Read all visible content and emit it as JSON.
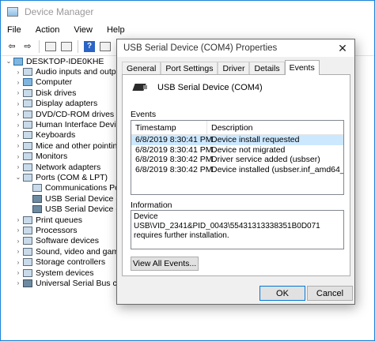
{
  "device_manager": {
    "title": "Device Manager",
    "menu": [
      "File",
      "Action",
      "View",
      "Help"
    ],
    "tree": [
      {
        "label": "DESKTOP-IDE0KHE",
        "expander": "⌄",
        "indent": 0,
        "icon": "computer-icon"
      },
      {
        "label": "Audio inputs and outpu",
        "expander": "›",
        "indent": 1,
        "icon": "audio-icon"
      },
      {
        "label": "Computer",
        "expander": "›",
        "indent": 1,
        "icon": "computer-icon"
      },
      {
        "label": "Disk drives",
        "expander": "›",
        "indent": 1,
        "icon": "disk-icon"
      },
      {
        "label": "Display adapters",
        "expander": "›",
        "indent": 1,
        "icon": "display-icon"
      },
      {
        "label": "DVD/CD-ROM drives",
        "expander": "›",
        "indent": 1,
        "icon": "dvd-icon"
      },
      {
        "label": "Human Interface Device",
        "expander": "›",
        "indent": 1,
        "icon": "hid-icon"
      },
      {
        "label": "Keyboards",
        "expander": "›",
        "indent": 1,
        "icon": "keyboard-icon"
      },
      {
        "label": "Mice and other pointing",
        "expander": "›",
        "indent": 1,
        "icon": "mouse-icon"
      },
      {
        "label": "Monitors",
        "expander": "›",
        "indent": 1,
        "icon": "monitor-icon"
      },
      {
        "label": "Network adapters",
        "expander": "›",
        "indent": 1,
        "icon": "network-icon"
      },
      {
        "label": "Ports (COM & LPT)",
        "expander": "⌄",
        "indent": 1,
        "icon": "port-icon"
      },
      {
        "label": "Communications Po",
        "expander": "",
        "indent": 2,
        "icon": "port-icon"
      },
      {
        "label": "USB Serial Device (C",
        "expander": "",
        "indent": 2,
        "icon": "usb-icon"
      },
      {
        "label": "USB Serial Device (C",
        "expander": "",
        "indent": 2,
        "icon": "usb-icon"
      },
      {
        "label": "Print queues",
        "expander": "›",
        "indent": 1,
        "icon": "printer-icon"
      },
      {
        "label": "Processors",
        "expander": "›",
        "indent": 1,
        "icon": "processor-icon"
      },
      {
        "label": "Software devices",
        "expander": "›",
        "indent": 1,
        "icon": "software-icon"
      },
      {
        "label": "Sound, video and game",
        "expander": "›",
        "indent": 1,
        "icon": "sound-icon"
      },
      {
        "label": "Storage controllers",
        "expander": "›",
        "indent": 1,
        "icon": "storage-icon"
      },
      {
        "label": "System devices",
        "expander": "›",
        "indent": 1,
        "icon": "system-icon"
      },
      {
        "label": "Universal Serial Bus cont",
        "expander": "›",
        "indent": 1,
        "icon": "usb-icon"
      }
    ]
  },
  "dialog": {
    "title": "USB Serial Device (COM4) Properties",
    "tabs": [
      "General",
      "Port Settings",
      "Driver",
      "Details",
      "Events"
    ],
    "active_tab": "Events",
    "device_name": "USB Serial Device (COM4)",
    "events_label": "Events",
    "columns": [
      "Timestamp",
      "Description"
    ],
    "events": [
      {
        "timestamp": "6/8/2019 8:30:41 PM",
        "description": "Device install requested"
      },
      {
        "timestamp": "6/8/2019 8:30:41 PM",
        "description": "Device not migrated"
      },
      {
        "timestamp": "6/8/2019 8:30:42 PM",
        "description": "Driver service added (usbser)"
      },
      {
        "timestamp": "6/8/2019 8:30:42 PM",
        "description": "Device installed (usbser.inf_amd64_1"
      }
    ],
    "information_label": "Information",
    "information_text": "Device USB\\VID_2341&PID_0043\\55431313338351B0D071 requires further installation.",
    "view_all_events": "View All Events...",
    "ok": "OK",
    "cancel": "Cancel"
  }
}
